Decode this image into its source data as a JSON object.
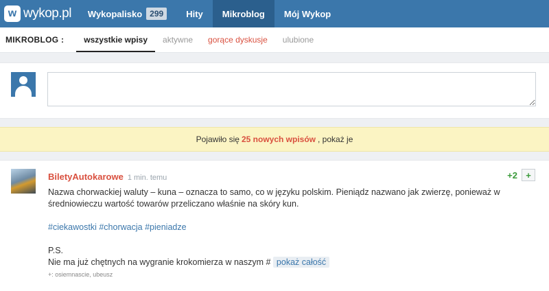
{
  "brand": {
    "logo_text": "wykop.pl",
    "logo_glyph": "w"
  },
  "topnav": {
    "items": [
      {
        "label": "Wykopalisko",
        "badge": "299"
      },
      {
        "label": "Hity"
      },
      {
        "label": "Mikroblog",
        "active": true
      },
      {
        "label": "Mój Wykop"
      }
    ]
  },
  "subnav": {
    "label": "MIKROBLOG :",
    "tabs": [
      "wszystkie wpisy",
      "aktywne",
      "gorące dyskusje",
      "ulubione"
    ]
  },
  "compose": {
    "placeholder": ""
  },
  "notice": {
    "before": "Pojawiło się",
    "highlight": "25 nowych wpisów",
    "after": ", pokaż je"
  },
  "entry": {
    "author": "BiletyAutokarowe",
    "time": "1 min. temu",
    "votes": "+2",
    "vote_button": "+",
    "text": "Nazwa chorwackiej waluty – kuna – oznacza to samo, co w języku polskim. Pieniądz nazwano jak zwierzę, ponieważ w średniowieczu wartość towarów przeliczano właśnie na skóry kun.",
    "tags": [
      "#ciekawostki",
      "#chorwacja",
      "#pieniadze"
    ],
    "ps": "P.S.",
    "more_text": "Nie ma już chętnych na wygranie krokomierza w naszym #",
    "show_more": "pokaż całość",
    "voters": "+: osiemnascie, ubeusz"
  },
  "colors": {
    "topbar": "#3b77ab",
    "accent_red": "#d9503f",
    "vote_green": "#3a9a3a",
    "notice_bg": "#fbf4c3"
  }
}
